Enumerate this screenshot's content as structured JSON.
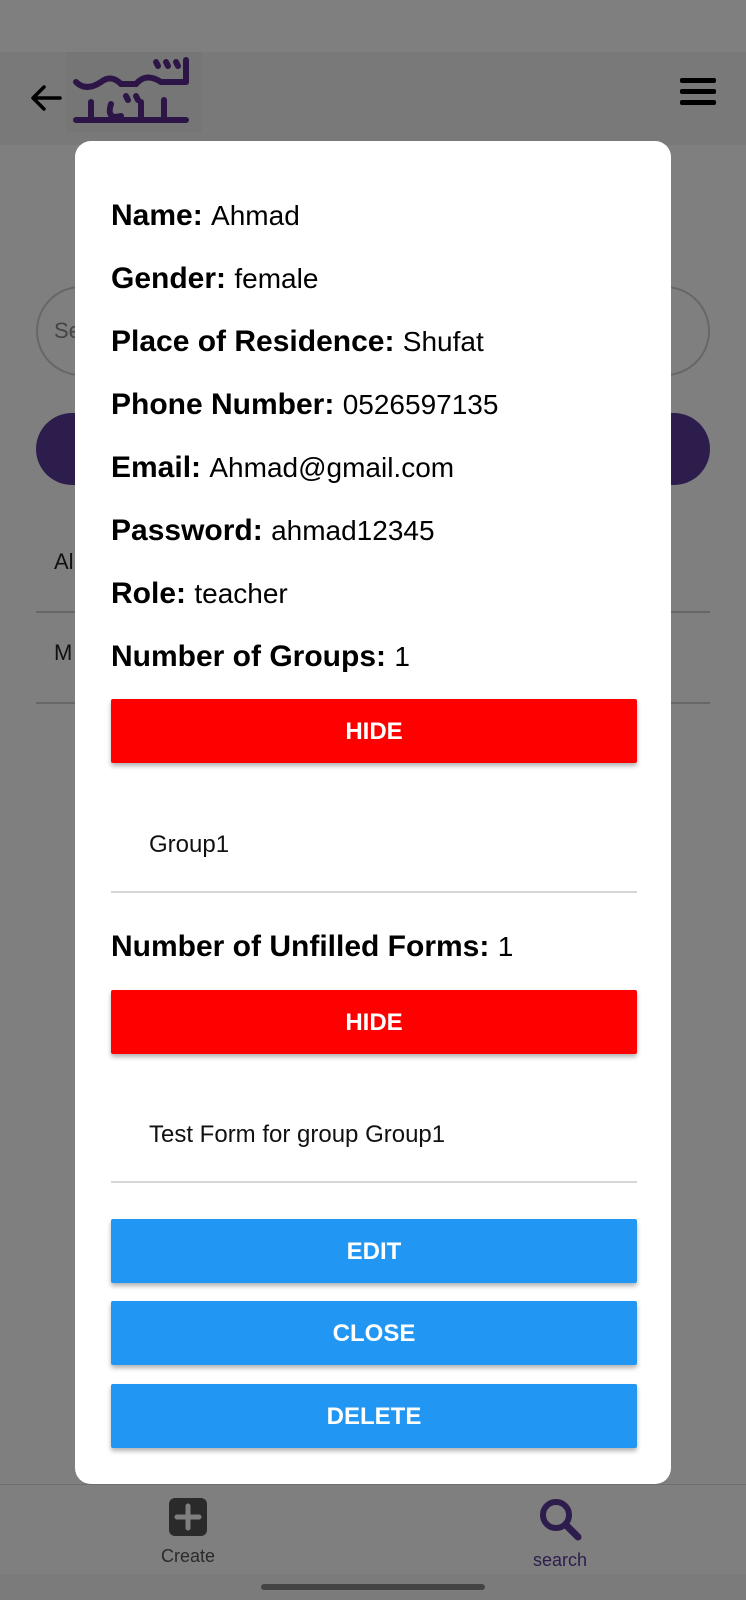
{
  "header": {
    "logo_text": "شطرنج القدس",
    "back_icon": "arrow-left-icon",
    "menu_icon": "hamburger-menu-icon"
  },
  "background": {
    "search_placeholder": "Se",
    "list_items": [
      "Al",
      "M"
    ]
  },
  "modal": {
    "fields": [
      {
        "label": "Name:",
        "value": "Ahmad"
      },
      {
        "label": "Gender:",
        "value": "female"
      },
      {
        "label": "Place of Residence:",
        "value": "Shufat"
      },
      {
        "label": "Phone Number:",
        "value": "0526597135"
      },
      {
        "label": "Email:",
        "value": "Ahmad@gmail.com"
      },
      {
        "label": "Password:",
        "value": "ahmad12345"
      },
      {
        "label": "Role:",
        "value": "teacher"
      },
      {
        "label": "Number of Groups:",
        "value": "1"
      }
    ],
    "groups_hide_label": "HIDE",
    "groups": [
      "Group1"
    ],
    "unfilled_forms": {
      "label": "Number of Unfilled Forms:",
      "value": "1"
    },
    "forms_hide_label": "HIDE",
    "forms": [
      "Test Form for group Group1"
    ],
    "edit_label": "EDIT",
    "close_label": "CLOSE",
    "delete_label": "DELETE"
  },
  "bottom_nav": {
    "create_label": "Create",
    "create_icon": "plus-square-icon",
    "search_label": "search",
    "search_icon": "search-icon"
  },
  "colors": {
    "brand_purple": "#5a3b9a",
    "hide_red": "#ff0000",
    "action_blue": "#2196f3"
  }
}
